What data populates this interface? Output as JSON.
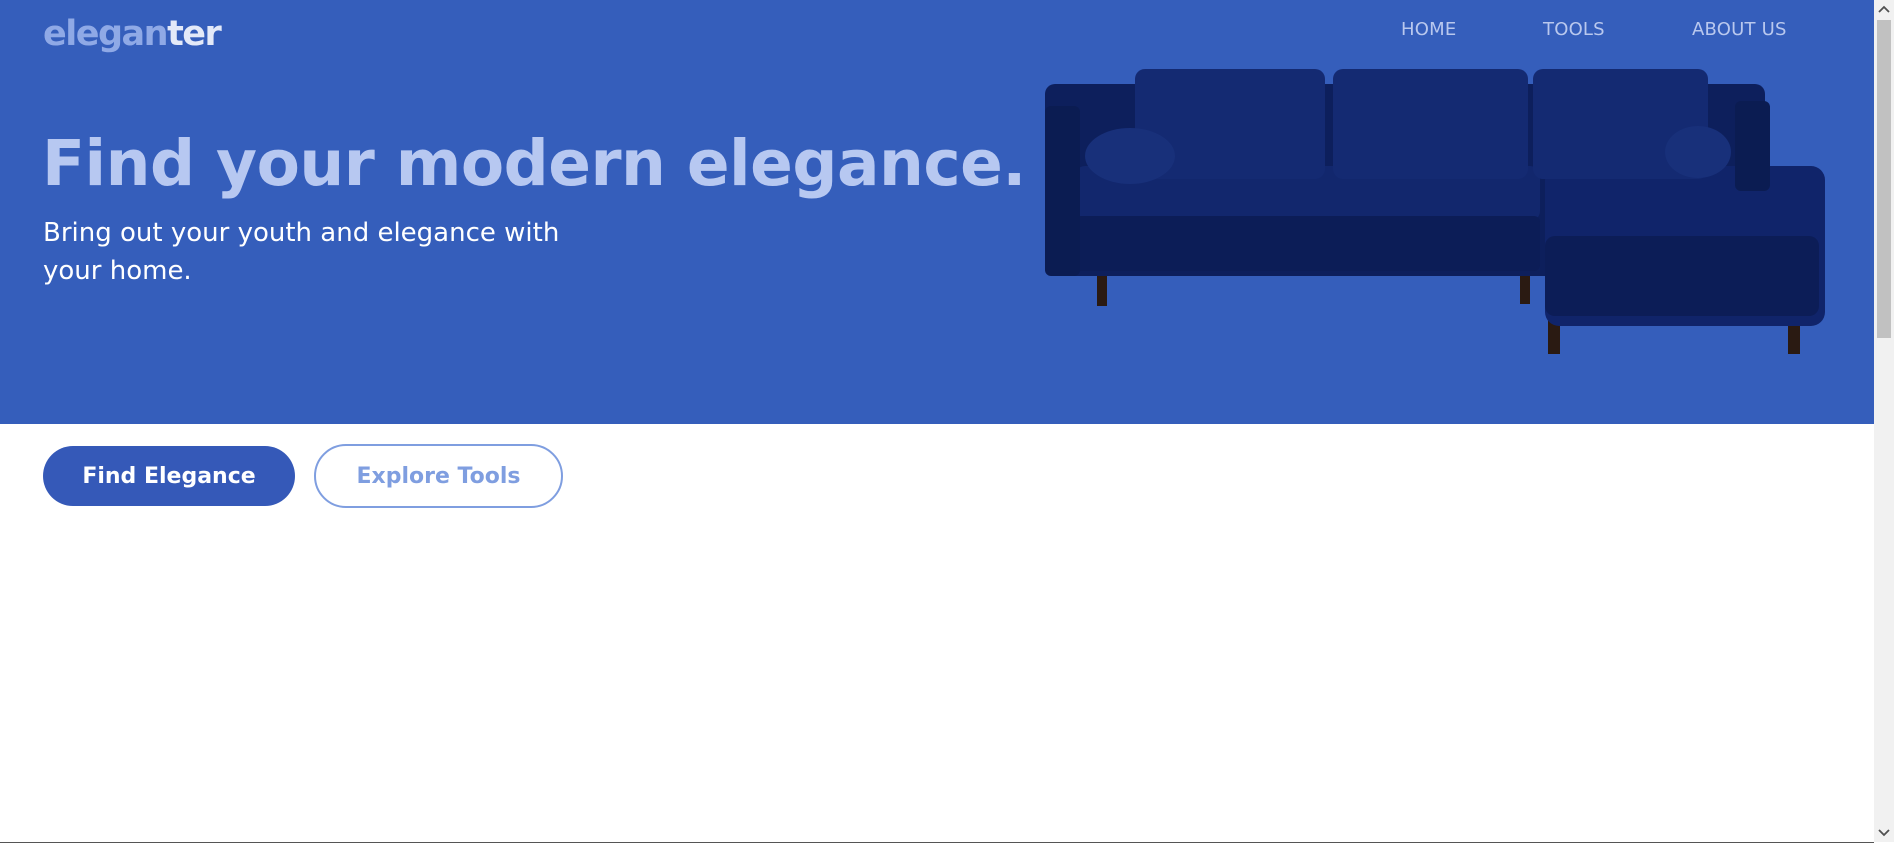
{
  "header": {
    "logo_part1": "elegan",
    "logo_part2": "ter",
    "nav": {
      "home": "HOME",
      "tools": "TOOLS",
      "about": "ABOUT US"
    }
  },
  "hero": {
    "headline": "Find your modern elegance.",
    "subhead": "Bring out your youth and elegance with your home.",
    "image_alt": "navy-velvet-sectional-sofa"
  },
  "actions": {
    "primary": "Find Elegance",
    "secondary": "Explore Tools"
  },
  "colors": {
    "brand_blue": "#355ebb",
    "button_blue": "#3559b8",
    "outline_blue": "#7f9ee0",
    "headline_tint": "#b7c8f1",
    "sofa_navy": "#0c1f5e"
  }
}
